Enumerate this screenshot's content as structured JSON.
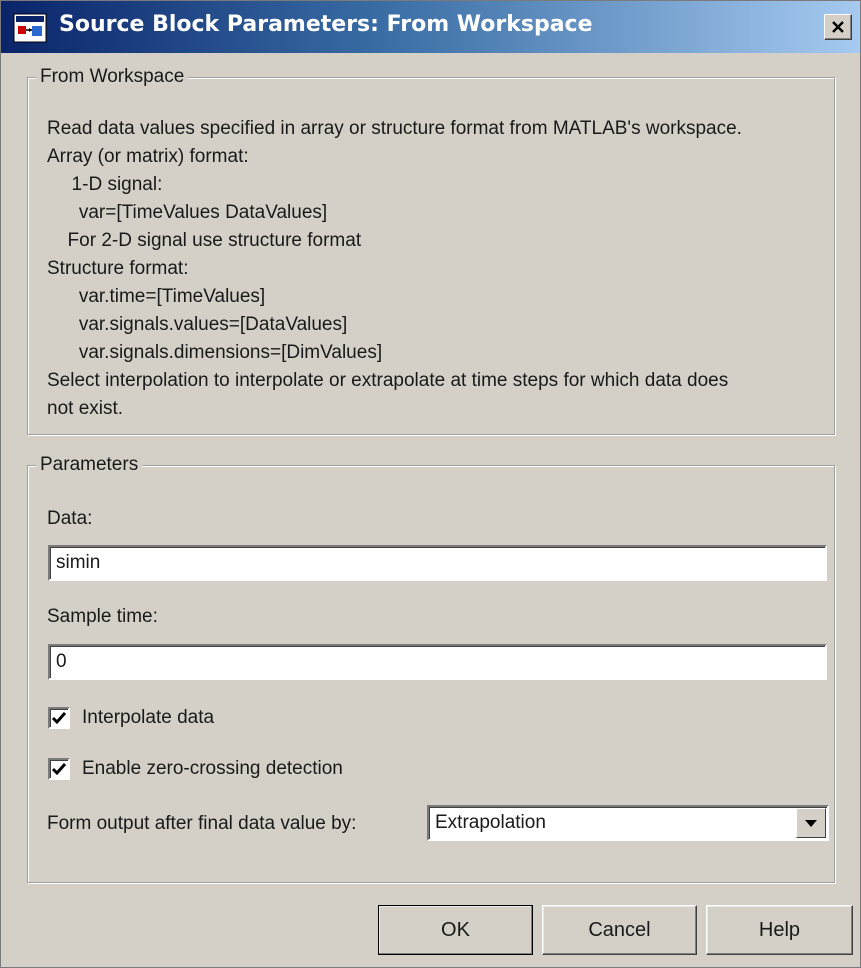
{
  "window": {
    "title": "Source Block Parameters: From Workspace"
  },
  "description_group": {
    "legend": "From Workspace",
    "lines": [
      "Read data values specified in array or structure format from MATLAB's workspace.",
      "Array (or matrix) format:",
      "  1-D signal:",
      "   var=[TimeValues DataValues]",
      "  For 2-D signal use structure format",
      "Structure format:",
      "   var.time=[TimeValues]",
      "   var.signals.values=[DataValues]",
      "   var.signals.dimensions=[DimValues]",
      "Select interpolation to interpolate or extrapolate at time steps for which data does",
      "not exist."
    ]
  },
  "parameters": {
    "legend": "Parameters",
    "data_label": "Data:",
    "data_value": "simin",
    "sample_time_label": "Sample time:",
    "sample_time_value": "0",
    "interpolate_label": "Interpolate data",
    "interpolate_checked": true,
    "zero_crossing_label": "Enable zero-crossing detection",
    "zero_crossing_checked": true,
    "form_output_label": "Form output after final data value by:",
    "form_output_value": "Extrapolation"
  },
  "buttons": {
    "ok": "OK",
    "cancel": "Cancel",
    "help": "Help"
  },
  "icons": {
    "app": "simulink-block-icon",
    "close": "close-icon",
    "check": "checkmark-icon",
    "dropdown": "chevron-down-icon"
  }
}
